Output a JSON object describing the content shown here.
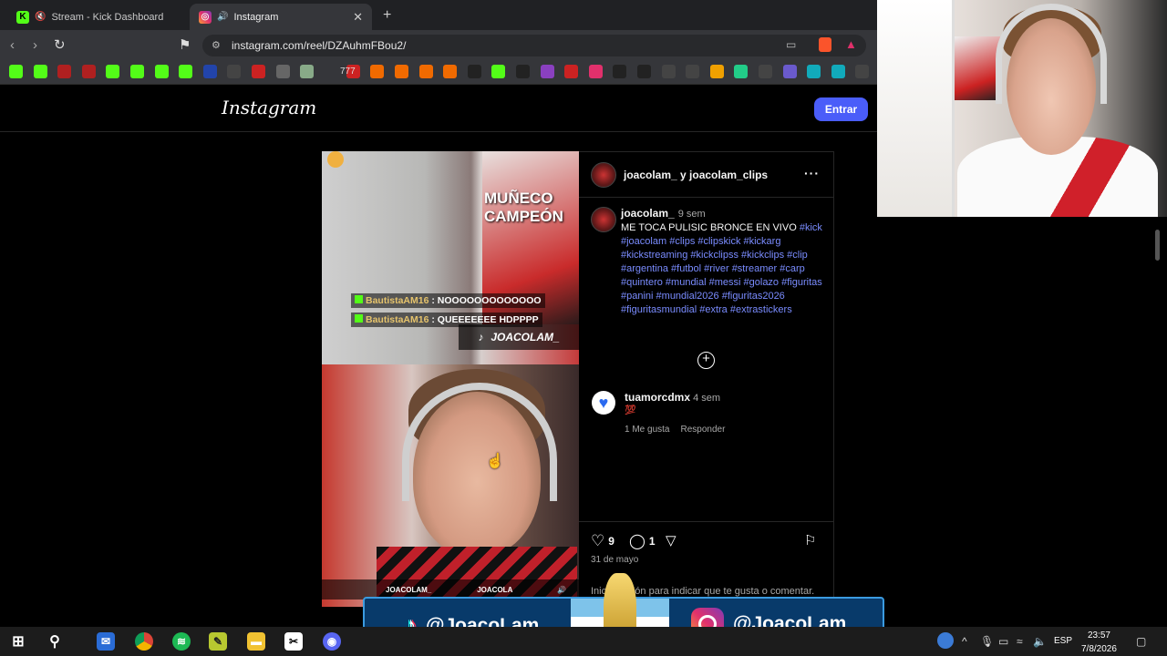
{
  "browser": {
    "tabs": [
      {
        "label": "Stream - Kick Dashboard",
        "active": false
      },
      {
        "label": "Instagram",
        "active": true
      }
    ],
    "new_tab": "+",
    "url": "instagram.com/reel/DZAuhmFBou2/",
    "bookmarks_text": "777"
  },
  "instagram": {
    "logo": "Instagram",
    "login_button": "Entrar",
    "post": {
      "authors": "joacolam_ y joacolam_clips",
      "more": "···",
      "caption_user": "joacolam_",
      "caption_time": "9 sem",
      "caption_text": "ME TOCA PULISIC BRONCE EN VIVO",
      "caption_tags": "#kick #joacolam #clips #clipskick #kickarg #kickstreaming #kickclipss #kickclips #clip #argentina #futbol #river #streamer #carp #quintero #mundial #messi #golazo #figuritas #panini #mundial2026 #figuritas2026 #figuritasmundial #extra #extrastickers",
      "add": "+",
      "likes": "9",
      "comments_count": "1",
      "date": "31 de mayo",
      "login_hint": "Inicia sesión para indicar que te gusta o comentar."
    },
    "comment": {
      "user": "tuamorcdmx",
      "time": "4 sem",
      "text": "💯",
      "likes": "1 Me gusta",
      "reply": "Responder"
    },
    "video": {
      "poster_text": "MUÑECO CAMPEÓN",
      "chat": [
        {
          "user": "BautistaAM16",
          "message": ": NOOOOOOOOOOOOO"
        },
        {
          "user": "BautistaAM16",
          "message": ": QUEEEEEEE HDPPPP"
        }
      ],
      "tiktok_handle": "JOACOLAM_",
      "bottom_tags": [
        "JOACOLAM_",
        "JOACOLA"
      ]
    }
  },
  "overlay": {
    "tiktok_handle": "@JoacoLam",
    "instagram_handle": "@JoacoLam"
  },
  "taskbar": {
    "lang": "ESP",
    "time": "23:57",
    "date": "7/8/2026"
  },
  "colors": {
    "accent": "#4a5df9",
    "hashtag": "#7a8cff",
    "kick_green": "#53fc18"
  }
}
